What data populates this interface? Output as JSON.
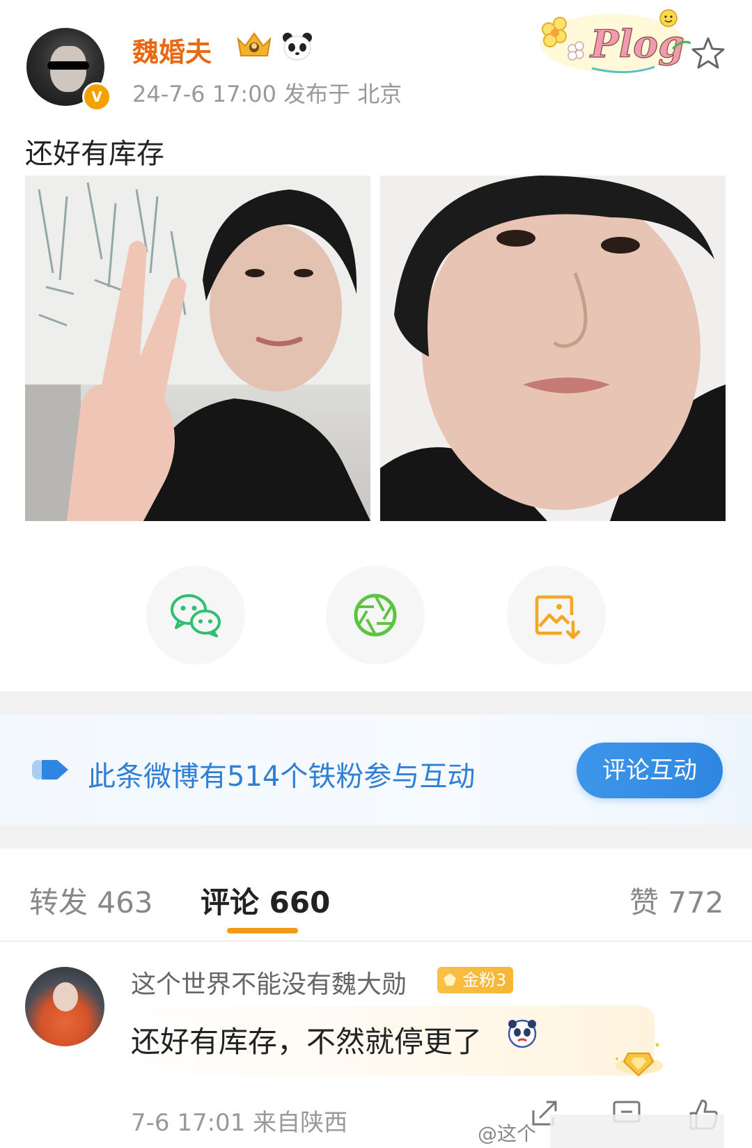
{
  "post": {
    "author": "魏婚夫",
    "meta": "24-7-6 17:00  发布于 北京",
    "text": "还好有库存",
    "sticker_text": "Plog",
    "icons": [
      "crown-icon",
      "panda-icon",
      "star-icon",
      "verified-icon"
    ],
    "images": [
      "selfie-peace-sign",
      "selfie-closeup"
    ]
  },
  "share": {
    "icons": [
      "wechat-icon",
      "moments-icon",
      "save-image-icon"
    ],
    "colors": {
      "wechat": "#2fbf71",
      "moments": "#5cc53f",
      "save": "#f5a623"
    }
  },
  "banner": {
    "text": "此条微博有514个铁粉参与互动",
    "button": "评论互动",
    "accent": "#2f7fd6"
  },
  "tabs": {
    "repost": "转发 463",
    "comment": "评论 660",
    "like": "赞 772",
    "active_color": "#f49a1a"
  },
  "comment": {
    "username": "这个世界不能没有魏大勋",
    "badge": "金粉3",
    "text": "还好有库存，不然就停更了",
    "meta": "7-6 17:01 来自陕西",
    "watermark": "@这个"
  }
}
